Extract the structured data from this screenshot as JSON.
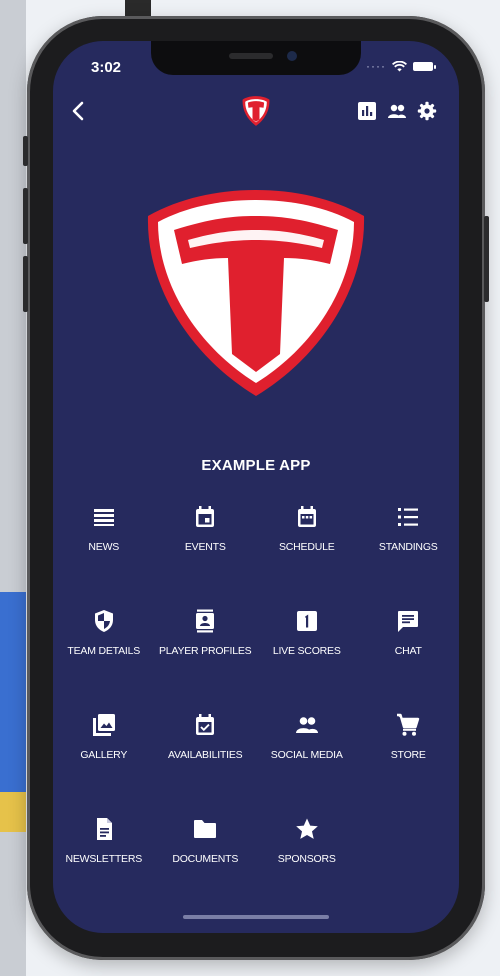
{
  "status_bar": {
    "time": "3:02"
  },
  "header": {
    "back_icon": "chevron-left-icon",
    "actions": [
      "chart-icon",
      "group-icon",
      "gear-icon"
    ]
  },
  "app": {
    "title": "EXAMPLE APP"
  },
  "brand": {
    "primary": "#262a5e",
    "accent": "#e0202e",
    "shield_white": "#ffffff"
  },
  "menu": [
    {
      "label": "NEWS",
      "icon": "news-icon"
    },
    {
      "label": "EVENTS",
      "icon": "calendar-event-icon"
    },
    {
      "label": "SCHEDULE",
      "icon": "calendar-icon"
    },
    {
      "label": "STANDINGS",
      "icon": "list-icon"
    },
    {
      "label": "TEAM DETAILS",
      "icon": "shield-icon"
    },
    {
      "label": "PLAYER PROFILES",
      "icon": "profile-card-icon"
    },
    {
      "label": "LIVE SCORES",
      "icon": "scoreboard-icon"
    },
    {
      "label": "CHAT",
      "icon": "chat-icon"
    },
    {
      "label": "GALLERY",
      "icon": "gallery-icon"
    },
    {
      "label": "AVAILABILITIES",
      "icon": "calendar-check-icon"
    },
    {
      "label": "SOCIAL MEDIA",
      "icon": "people-icon"
    },
    {
      "label": "STORE",
      "icon": "cart-icon"
    },
    {
      "label": "NEWSLETTERS",
      "icon": "document-icon"
    },
    {
      "label": "DOCUMENTS",
      "icon": "folder-icon"
    },
    {
      "label": "SPONSORS",
      "icon": "star-icon"
    }
  ]
}
